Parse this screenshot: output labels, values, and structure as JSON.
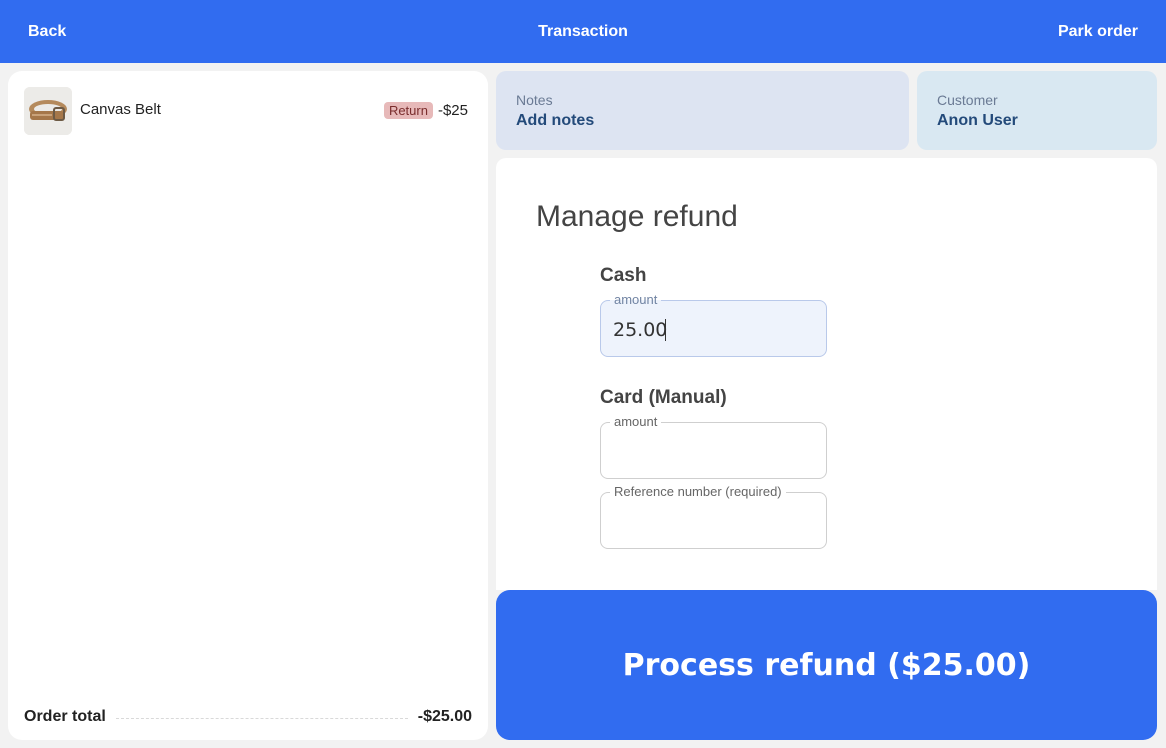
{
  "header": {
    "back_label": "Back",
    "title": "Transaction",
    "park_label": "Park order"
  },
  "order": {
    "items": [
      {
        "name": "Canvas Belt",
        "badge": "Return",
        "price": "-$25",
        "image_icon": "belt-photo"
      }
    ],
    "total_label": "Order total",
    "total_value": "-$25.00"
  },
  "notes": {
    "label": "Notes",
    "value": "Add notes"
  },
  "customer": {
    "label": "Customer",
    "value": "Anon User"
  },
  "refund": {
    "title": "Manage refund",
    "cash": {
      "label": "Cash",
      "amount_label": "amount",
      "amount_value": "25.00"
    },
    "card": {
      "label": "Card (Manual)",
      "amount_label": "amount",
      "amount_value": "",
      "reference_label": "Reference number (required)",
      "reference_value": ""
    },
    "process_label": "Process refund ($25.00)"
  },
  "colors": {
    "primary": "#316cf0",
    "return_badge": "#e7b9b9",
    "notes_bg": "#dde4f2",
    "customer_bg": "#d9e8f2"
  }
}
